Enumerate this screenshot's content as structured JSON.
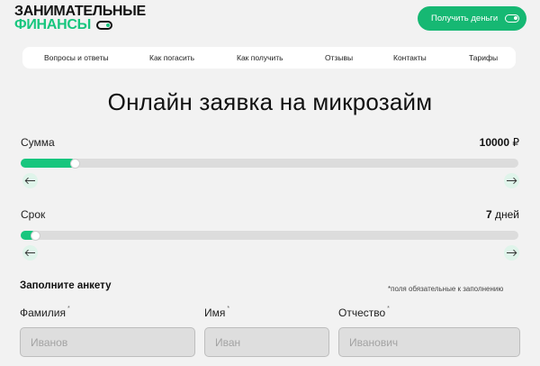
{
  "header": {
    "logo_line1": "ЗАНИМАТЕЛЬНЫЕ",
    "logo_line2": "ФИНАНСЫ",
    "cta_label": "Получить деньги"
  },
  "nav": {
    "items": [
      "Вопросы и ответы",
      "Как погасить",
      "Как получить",
      "Отзывы",
      "Контакты",
      "Тарифы"
    ]
  },
  "page_title": "Онлайн заявка на микрозайм",
  "amount": {
    "label": "Сумма",
    "value": "10000",
    "unit": "₽",
    "fill_fraction": 0.1
  },
  "term": {
    "label": "Срок",
    "value": "7",
    "unit": "дней",
    "fill_fraction": 0.02
  },
  "form": {
    "title": "Заполните анкету",
    "note": "*поля обязательные к заполнению",
    "required_mark": "*",
    "fields": [
      {
        "label": "Фамилия",
        "placeholder": "Иванов"
      },
      {
        "label": "Имя",
        "placeholder": "Иван"
      },
      {
        "label": "Отчество",
        "placeholder": "Иванович"
      }
    ]
  },
  "colors": {
    "accent": "#17c67e",
    "accent_dark": "#16b873",
    "track": "#dcdcdc",
    "arrow_bg": "#dff4ea"
  },
  "icons": {
    "logo_toggle": "toggle-icon",
    "cta_toggle": "toggle-icon",
    "arrow_left": "arrow-left-icon",
    "arrow_right": "arrow-right-icon"
  }
}
